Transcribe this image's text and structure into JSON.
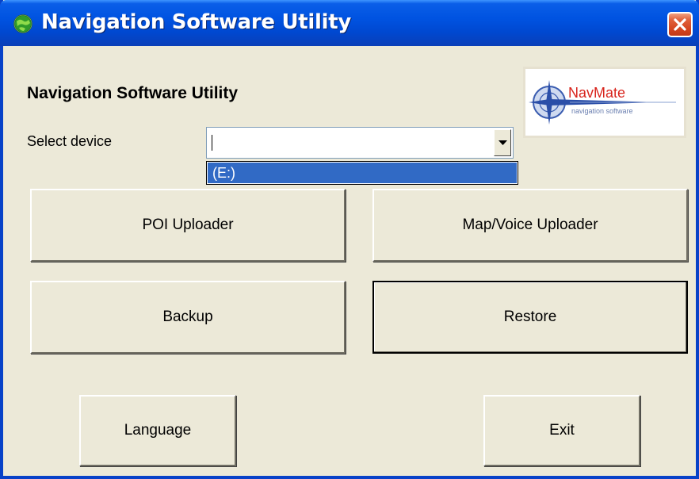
{
  "window": {
    "title": "Navigation Software Utility",
    "icon": "app-globe-icon",
    "close_icon": "close-icon"
  },
  "main": {
    "heading": "Navigation Software Utility",
    "select_label": "Select device",
    "device_value": "",
    "device_options": [
      "(E:)"
    ],
    "logo": {
      "name": "NavMate",
      "tagline": "navigation software"
    }
  },
  "buttons": {
    "poi_uploader": "POI Uploader",
    "map_voice_uploader": "Map/Voice Uploader",
    "backup": "Backup",
    "restore": "Restore",
    "language": "Language",
    "exit": "Exit"
  },
  "colors": {
    "titlebar": "#0053e1",
    "selection": "#316ac5",
    "dialog_bg": "#ece9d8",
    "close_button": "#d4451f",
    "logo_red": "#d8241c"
  }
}
